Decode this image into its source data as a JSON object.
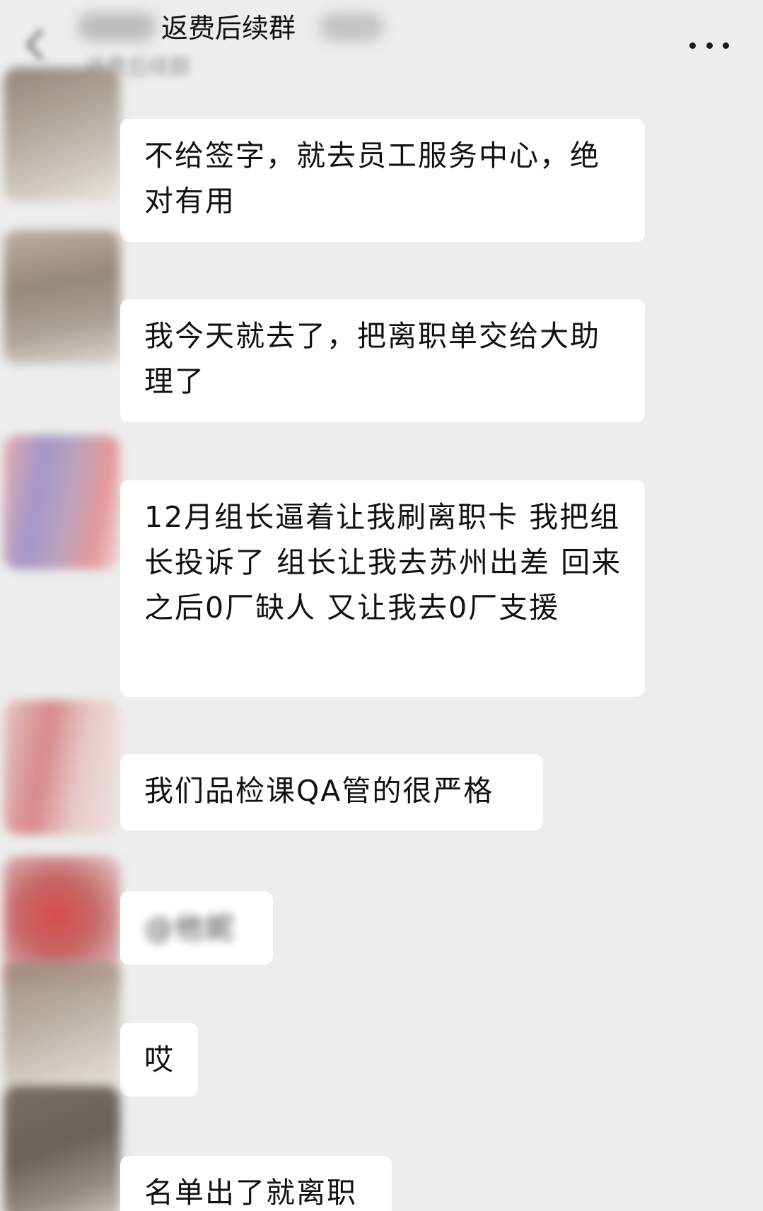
{
  "header": {
    "title": "返费后续群",
    "title_prefix": "",
    "subtitle": "返费后续群",
    "back_icon": "chevron-left-icon",
    "more_icon": "more-dots-icon"
  },
  "messages": [
    {
      "sender": "",
      "text": "不给签字，就去员工服务中心，绝对有用"
    },
    {
      "sender": "",
      "text": "我今天就去了，把离职单交给大助理了"
    },
    {
      "sender": "",
      "text": "12月组长逼着让我刷离职卡 我把组长投诉了 组长让我去苏州出差 回来之后0厂缺人 又让我去0厂支援"
    },
    {
      "sender": "",
      "text": "我们品检课QA管的很严格"
    },
    {
      "sender": "",
      "text": "@他妮"
    },
    {
      "sender": "",
      "text": "哎"
    },
    {
      "sender": "",
      "text": "名单出了就离职"
    }
  ]
}
